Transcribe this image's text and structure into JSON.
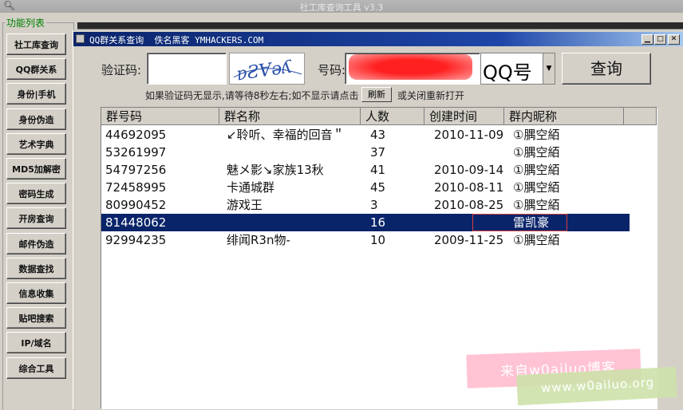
{
  "window": {
    "title": "社工库查询工具 v3.3"
  },
  "sidebar": {
    "legend": "功能列表",
    "items": [
      "社工库查询",
      "QQ群关系",
      "身份|手机",
      "身份伪造",
      "艺术字典",
      "MD5加解密",
      "密码生成",
      "开房查询",
      "邮件伪造",
      "数据查找",
      "信息收集",
      "贴吧搜索",
      "IP/域名",
      "综合工具"
    ]
  },
  "child": {
    "title": "QQ群关系查询  佚名黑客 YMHACKERS.COM",
    "captcha_label": "验证码:",
    "captcha_value": "",
    "captcha_image_text": "ɐƧⱯəʎ",
    "number_label": "号码:",
    "query_type": "QQ号",
    "query_button": "查询",
    "hint": "如果验证码无显示,请等待8秒左右;如不显示请点击",
    "refresh_button": "刷新",
    "hint_tail": "或关闭重新打开"
  },
  "table": {
    "columns": [
      "群号码",
      "群名称",
      "人数",
      "创建时间",
      "群内昵称"
    ],
    "rows": [
      {
        "id": "44692095",
        "name": "↙聆听、幸福的回音＂",
        "count": "43",
        "created": "2010-11-09",
        "nick": "①腢空絔"
      },
      {
        "id": "53261997",
        "name": "",
        "count": "37",
        "created": "",
        "nick": "①腢空絔"
      },
      {
        "id": "54797256",
        "name": "魅メ影↘家族13秋",
        "count": "41",
        "created": "2010-09-14",
        "nick": "①腢空絔"
      },
      {
        "id": "72458995",
        "name": "卡通城群",
        "count": "45",
        "created": "2010-08-11",
        "nick": "①腢空絔"
      },
      {
        "id": "80990452",
        "name": "游戏王",
        "count": "3",
        "created": "2010-08-25",
        "nick": "①腢空絔"
      },
      {
        "id": "81448062",
        "name": "",
        "count": "16",
        "created": "",
        "nick": "雷凯豪"
      },
      {
        "id": "92994235",
        "name": "绯闻R3n物-",
        "count": "10",
        "created": "2009-11-25",
        "nick": "①腢空絔"
      }
    ],
    "selected_index": 5
  },
  "watermark": {
    "line1": "来自w0ailuo博客",
    "line2": "www.w0ailuo.org"
  }
}
